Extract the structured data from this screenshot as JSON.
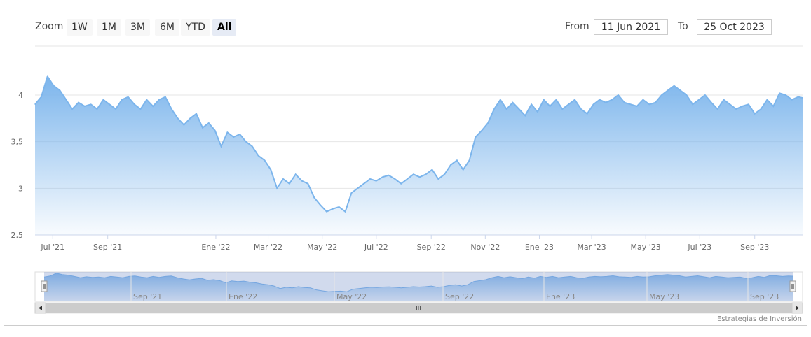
{
  "range_selector": {
    "zoom_label": "Zoom",
    "buttons": [
      "1W",
      "1M",
      "3M",
      "6M",
      "YTD",
      "All"
    ],
    "active": "All",
    "from_label": "From",
    "from_value": "11 Jun 2021",
    "to_label": "To",
    "to_value": "25 Oct 2023"
  },
  "credits": "Estrategias de Inversión",
  "navigator_labels": [
    "Sep '21",
    "Ene '22",
    "May '22",
    "Sep '22",
    "Ene '23",
    "May '23",
    "Sep '23"
  ],
  "scrollbar_grip": "III",
  "colors": {
    "line": "#7cb5ec",
    "fill_top": "#7cb5ec",
    "navigator_mask": "#6685c2"
  },
  "chart_data": {
    "type": "area",
    "x_range": [
      "2021-06-11",
      "2023-10-25"
    ],
    "y_ticks": [
      "2,5",
      "3",
      "3,5",
      "4"
    ],
    "ylim": [
      2.5,
      4.0
    ],
    "x_tick_labels": [
      "Jul '21",
      "Sep '21",
      "Ene '22",
      "Mar '22",
      "May '22",
      "Jul '22",
      "Sep '22",
      "Nov '22",
      "Ene '23",
      "Mar '23",
      "May '23",
      "Jul '23",
      "Sep '23"
    ],
    "x_tick_dates": [
      "2021-07-01",
      "2021-09-01",
      "2022-01-01",
      "2022-03-01",
      "2022-05-01",
      "2022-07-01",
      "2022-09-01",
      "2022-11-01",
      "2023-01-01",
      "2023-03-01",
      "2023-05-01",
      "2023-07-01",
      "2023-09-01"
    ],
    "grid": true,
    "series": [
      {
        "x": [
          "2021-06-11",
          "2021-06-18",
          "2021-06-25",
          "2021-07-02",
          "2021-07-09",
          "2021-07-16",
          "2021-07-23",
          "2021-07-30",
          "2021-08-06",
          "2021-08-13",
          "2021-08-20",
          "2021-08-27",
          "2021-09-03",
          "2021-09-10",
          "2021-09-17",
          "2021-09-24",
          "2021-10-01",
          "2021-10-08",
          "2021-10-15",
          "2021-10-22",
          "2021-10-29",
          "2021-11-05",
          "2021-11-12",
          "2021-11-19",
          "2021-11-26",
          "2021-12-03",
          "2021-12-10",
          "2021-12-17",
          "2021-12-24",
          "2021-12-31",
          "2022-01-07",
          "2022-01-14",
          "2022-01-21",
          "2022-01-28",
          "2022-02-04",
          "2022-02-11",
          "2022-02-18",
          "2022-02-25",
          "2022-03-04",
          "2022-03-11",
          "2022-03-18",
          "2022-03-25",
          "2022-04-01",
          "2022-04-08",
          "2022-04-15",
          "2022-04-22",
          "2022-04-29",
          "2022-05-06",
          "2022-05-13",
          "2022-05-20",
          "2022-05-27",
          "2022-06-03",
          "2022-06-10",
          "2022-06-17",
          "2022-06-24",
          "2022-07-01",
          "2022-07-08",
          "2022-07-15",
          "2022-07-22",
          "2022-07-29",
          "2022-08-05",
          "2022-08-12",
          "2022-08-19",
          "2022-08-26",
          "2022-09-02",
          "2022-09-09",
          "2022-09-16",
          "2022-09-23",
          "2022-09-30",
          "2022-10-07",
          "2022-10-14",
          "2022-10-21",
          "2022-10-28",
          "2022-11-04",
          "2022-11-11",
          "2022-11-18",
          "2022-11-25",
          "2022-12-02",
          "2022-12-09",
          "2022-12-16",
          "2022-12-23",
          "2022-12-30",
          "2023-01-06",
          "2023-01-13",
          "2023-01-20",
          "2023-01-27",
          "2023-02-03",
          "2023-02-10",
          "2023-02-17",
          "2023-02-24",
          "2023-03-03",
          "2023-03-10",
          "2023-03-17",
          "2023-03-24",
          "2023-03-31",
          "2023-04-07",
          "2023-04-14",
          "2023-04-21",
          "2023-04-28",
          "2023-05-05",
          "2023-05-12",
          "2023-05-19",
          "2023-05-26",
          "2023-06-02",
          "2023-06-09",
          "2023-06-16",
          "2023-06-23",
          "2023-06-30",
          "2023-07-07",
          "2023-07-14",
          "2023-07-21",
          "2023-07-28",
          "2023-08-04",
          "2023-08-11",
          "2023-08-18",
          "2023-08-25",
          "2023-09-01",
          "2023-09-08",
          "2023-09-15",
          "2023-09-22",
          "2023-09-29",
          "2023-10-06",
          "2023-10-13",
          "2023-10-20",
          "2023-10-25"
        ],
        "y": [
          3.9,
          3.98,
          4.2,
          4.1,
          4.05,
          3.95,
          3.85,
          3.92,
          3.88,
          3.9,
          3.85,
          3.95,
          3.9,
          3.85,
          3.95,
          3.98,
          3.9,
          3.85,
          3.95,
          3.88,
          3.95,
          3.98,
          3.85,
          3.75,
          3.68,
          3.75,
          3.8,
          3.65,
          3.7,
          3.62,
          3.45,
          3.6,
          3.55,
          3.58,
          3.5,
          3.45,
          3.35,
          3.3,
          3.2,
          3.0,
          3.1,
          3.05,
          3.15,
          3.08,
          3.05,
          2.9,
          2.82,
          2.75,
          2.78,
          2.8,
          2.75,
          2.95,
          3.0,
          3.05,
          3.1,
          3.08,
          3.12,
          3.14,
          3.1,
          3.05,
          3.1,
          3.15,
          3.12,
          3.15,
          3.2,
          3.1,
          3.15,
          3.25,
          3.3,
          3.2,
          3.3,
          3.55,
          3.62,
          3.7,
          3.85,
          3.95,
          3.85,
          3.92,
          3.85,
          3.78,
          3.9,
          3.82,
          3.95,
          3.88,
          3.95,
          3.85,
          3.9,
          3.95,
          3.85,
          3.8,
          3.9,
          3.95,
          3.92,
          3.95,
          4.0,
          3.92,
          3.9,
          3.88,
          3.95,
          3.9,
          3.92,
          4.0,
          4.05,
          4.1,
          4.05,
          4.0,
          3.9,
          3.95,
          4.0,
          3.92,
          3.85,
          3.95,
          3.9,
          3.85,
          3.88,
          3.9,
          3.8,
          3.85,
          3.95,
          3.88,
          4.02,
          4.0,
          3.95,
          3.98,
          3.97
        ]
      }
    ]
  }
}
